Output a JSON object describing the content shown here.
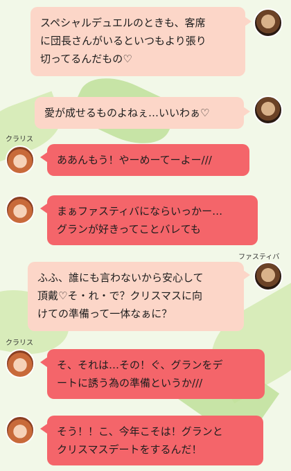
{
  "messages": [
    {
      "speaker": "",
      "text": "スペシャルデュエルのときも、客席\nに団長さんがいるといつもより張り\n切ってるんだもの♡",
      "side": "right",
      "color": "#fcd6c8"
    },
    {
      "speaker": "",
      "text": "愛が成せるものよねぇ…いいわぁ♡",
      "side": "right",
      "color": "#fcd6c8"
    },
    {
      "speaker": "クラリス",
      "text": "ああんもう！やーめーてーよー///",
      "side": "left",
      "color": "#f4656a"
    },
    {
      "speaker": "",
      "text": "まぁファスティバにならいっかー…\nグランが好きってことバレても",
      "side": "left",
      "color": "#f4656a"
    },
    {
      "speaker": "ファスティバ",
      "text": "ふふ、誰にも言わないから安心して\n頂戴♡そ・れ・で？クリスマスに向\nけての準備って一体なぁに？",
      "side": "right",
      "color": "#fcd6c8"
    },
    {
      "speaker": "クラリス",
      "text": "そ、それは…その！ぐ、グランをデ\nートに誘う為の準備というか///",
      "side": "left",
      "color": "#f4656a"
    },
    {
      "speaker": "",
      "text": "そう！！こ、今年こそは！グランと\nクリスマスデートをするんだ！",
      "side": "left",
      "color": "#f4656a"
    }
  ],
  "avatars": {
    "right": "fastiva-avatar",
    "left": "clarisse-avatar"
  }
}
